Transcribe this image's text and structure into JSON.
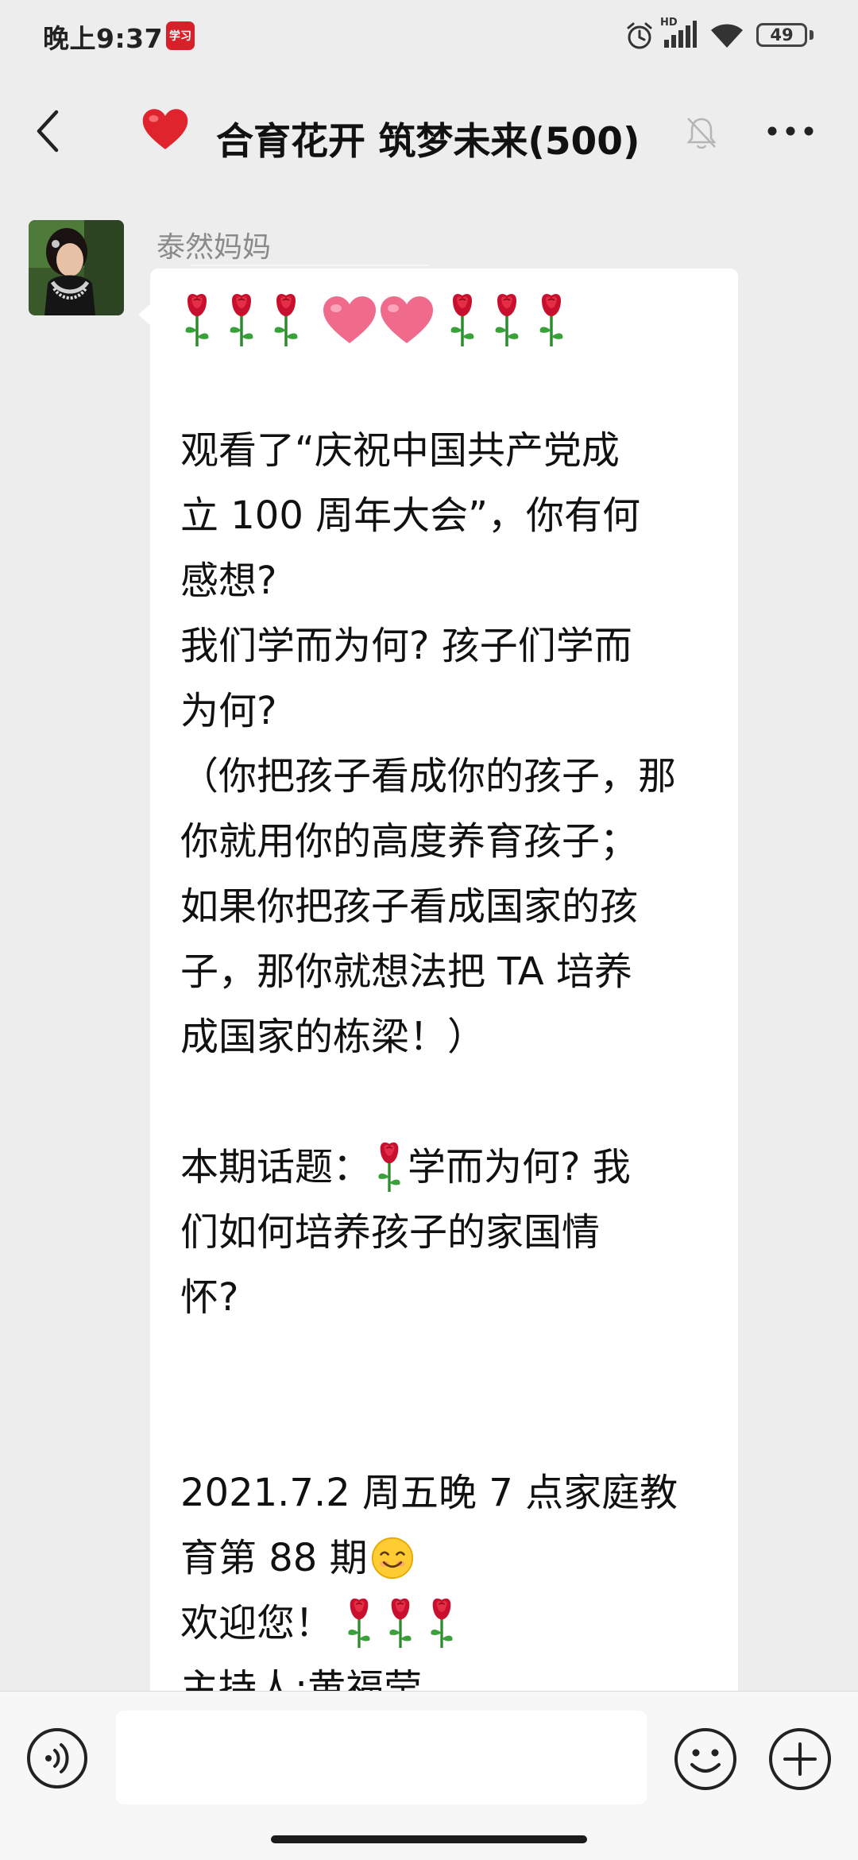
{
  "status_bar": {
    "time": "晚上9:37",
    "app_icon_label": "学习",
    "network_label": "HD",
    "battery_level": "49",
    "icons": [
      "alarm-icon",
      "signal-icon",
      "wifi-icon",
      "battery-icon"
    ]
  },
  "header": {
    "title": "合育花开 筑梦未来(500)",
    "title_emoji": "heart-icon",
    "muted": true,
    "icons": [
      "back-arrow-icon",
      "heart-icon",
      "mute-bell-icon",
      "more-dots-icon"
    ]
  },
  "message": {
    "sender": "泰然妈妈",
    "emoji_header": [
      "rose",
      "rose",
      "rose",
      "heart",
      "heart",
      "rose",
      "rose",
      "rose"
    ],
    "lines": {
      "l1": "观看了“庆祝中国共产党成",
      "l2": "立 100 周年大会”，你有何",
      "l3": "感想?",
      "l4": "我们学而为何? 孩子们学而",
      "l5": "为何?",
      "l6": "（你把孩子看成你的孩子，那",
      "l7": "你就用你的高度养育孩子；",
      "l8": "如果你把孩子看成国家的孩",
      "l9": "子，那你就想法把 TA 培养",
      "l10": "成国家的栋梁！）",
      "l11a": "本期话题：",
      "l11b": "学而为何? 我",
      "l12": "们如何培养孩子的家国情",
      "l13": "怀?",
      "l14": "2021.7.2 周五晚 7 点家庭教",
      "l15": "育第 88 期",
      "l16": "欢迎您！",
      "l17": "主持人:黄福莹"
    }
  },
  "input_bar": {
    "placeholder": "",
    "icons": [
      "voice-icon",
      "emoji-icon",
      "plus-icon"
    ]
  },
  "colors": {
    "background": "#ededed",
    "bubble": "#ffffff",
    "sender_name": "#8a8a8a",
    "heart_red": "#e0242e",
    "rose_red": "#c8102e",
    "pink_heart": "#f06a8c"
  }
}
